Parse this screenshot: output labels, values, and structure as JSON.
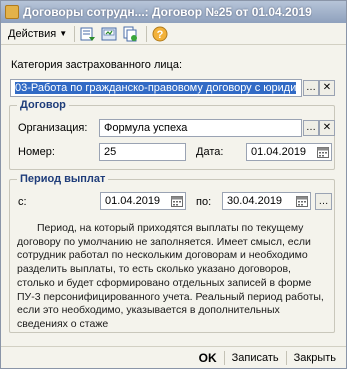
{
  "window": {
    "title": "Договоры сотрудн...: Договор №25 от 01.04.2019"
  },
  "toolbar": {
    "actions_label": "Действия",
    "buttons": [
      "post-document-icon",
      "save-icon",
      "copy-icon",
      "help-icon"
    ]
  },
  "category": {
    "label": "Категория застрахованного лица:",
    "value": "03-Работа по гражданско-правовому договору с юриди"
  },
  "contract": {
    "group_title": "Договор",
    "org_label": "Организация:",
    "org_value": "Формула успеха",
    "number_label": "Номер:",
    "number_value": "25",
    "date_label": "Дата:",
    "date_value": "01.04.2019"
  },
  "period": {
    "group_title": "Период выплат",
    "from_label": "с:",
    "from_value": "01.04.2019",
    "to_label": "по:",
    "to_value": "30.04.2019",
    "info_text": "Период, на который приходятся выплаты по текущему договору по умолчанию не заполняется. Имеет смысл, если сотрудник работал по нескольким договорам и необходимо разделить выплаты, то есть сколько указано договоров, столько и будет сформировано отдельных записей в форме ПУ-3 персонифицированного учета. Реальный период работы, если это необходимо, указывается в дополнительных сведениях о стаже"
  },
  "footer": {
    "ok_label": "OK",
    "save_label": "Записать",
    "close_label": "Закрыть"
  },
  "colors": {
    "accent": "#1f3d7a",
    "selection": "#316ac5"
  }
}
